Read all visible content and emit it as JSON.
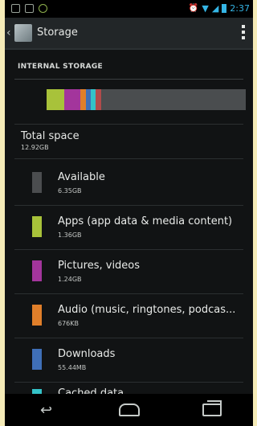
{
  "statusbar": {
    "time": "2:37"
  },
  "actionbar": {
    "title": "Storage"
  },
  "section": {
    "header": "INTERNAL STORAGE"
  },
  "usage_colors": {
    "apps": "#a8c23a",
    "pictures": "#a3359c",
    "audio": "#e07f2a",
    "downloads": "#3f6fb7",
    "cached": "#34c2c8",
    "misc": "#b14b4b",
    "available": "#4a4d4f"
  },
  "total": {
    "label": "Total space",
    "value": "12.92GB"
  },
  "items": [
    {
      "label": "Available",
      "size": "6.35GB",
      "color": "#4b4d4f"
    },
    {
      "label": "Apps (app data & media content)",
      "size": "1.36GB",
      "color": "#a8c23a"
    },
    {
      "label": "Pictures, videos",
      "size": "1.24GB",
      "color": "#a3359c"
    },
    {
      "label": "Audio (music, ringtones, podcas...",
      "size": "676KB",
      "color": "#e07f2a"
    },
    {
      "label": "Downloads",
      "size": "55.44MB",
      "color": "#3f6fb7"
    },
    {
      "label": "Cached data",
      "size": "",
      "color": "#34c2c8"
    }
  ]
}
